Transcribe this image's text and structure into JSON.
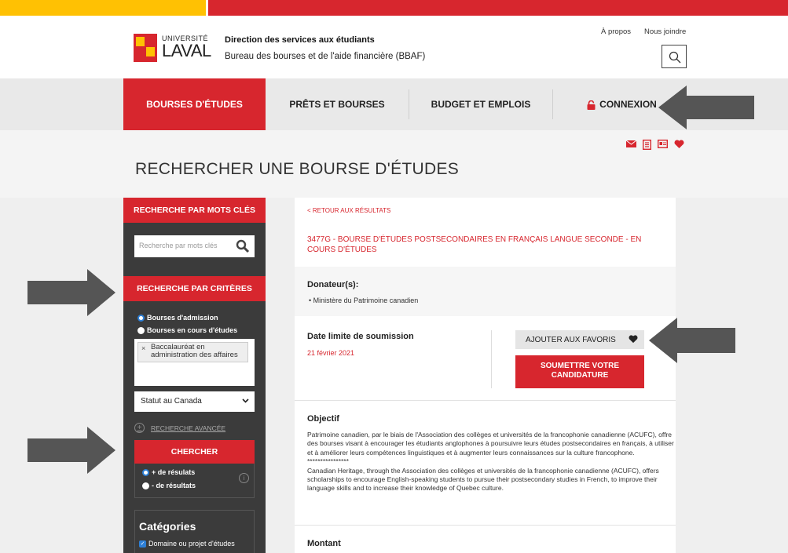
{
  "header": {
    "logo_small": "UNIVERSITÉ",
    "logo_large": "LAVAL",
    "title": "Direction des services aux étudiants",
    "subtitle": "Bureau des bourses et de l'aide financière (BBAF)",
    "links": [
      "À propos",
      "Nous joindre"
    ]
  },
  "nav": {
    "items": [
      {
        "label": "BOURSES D'ÉTUDES",
        "active": true
      },
      {
        "label": "PRÊTS ET BOURSES",
        "active": false
      },
      {
        "label": "BUDGET ET EMPLOIS",
        "active": false
      },
      {
        "label": "CONNEXION",
        "active": false,
        "icon": "lock-icon"
      }
    ]
  },
  "toolbar_icons": [
    "mail-icon",
    "document-icon",
    "card-icon",
    "heart-icon"
  ],
  "page_title": "RECHERCHER UNE BOURSE D'ÉTUDES",
  "sidebar": {
    "keyword_header": "RECHERCHE PAR MOTS CLÉS",
    "keyword_placeholder": "Recherche par mots clés",
    "criteria_header": "RECHERCHE PAR CRITÈRES",
    "radio_options": [
      {
        "label": "Bourses d'admission",
        "checked": true
      },
      {
        "label": "Bourses en cours d'études",
        "checked": false
      }
    ],
    "selected_tag": "Baccalauréat en administration des affaires",
    "status_select": "Statut au Canada",
    "advanced_link": "RECHERCHE AVANCÉE",
    "search_button": "CHERCHER",
    "sort_options": [
      {
        "label": "+ de résulats",
        "checked": true
      },
      {
        "label": "- de résultats",
        "checked": false
      }
    ],
    "info_glyph": "i",
    "categories_title": "Catégories",
    "category_checked": "Domaine ou projet d'études"
  },
  "main": {
    "back_link": "< RETOUR AUX RÉSULTATS",
    "title": "3477G - BOURSE D'ÉTUDES POSTSECONDAIRES EN FRANÇAIS LANGUE SECONDE - EN COURS D'ÉTUDES",
    "donors_label": "Donateur(s):",
    "donors": [
      "Ministère du Patrimoine canadien"
    ],
    "deadline_label": "Date limite de soumission",
    "deadline": "21 février 2021",
    "favorite_button": "AJOUTER AUX FAVORIS",
    "submit_button": "SOUMETTRE VOTRE CANDIDATURE",
    "objective_label": "Objectif",
    "objective_fr": "Patrimoine canadien, par le biais de l'Association des collèges et universités de la francophonie canadienne (ACUFC), offre des bourses visant à encourager les étudiants anglophones à poursuivre leurs études postsecondaires en français, à utiliser et à améliorer leurs compétences linguistiques et à augmenter leurs connaissances sur la culture francophone.",
    "objective_sep": "****************",
    "objective_en": "Canadian Heritage, through the Association des collèges et universités de la francophonie canadienne (ACUFC), offers scholarships to encourage English-speaking students to pursue their postsecondary studies in French, to improve their language skills and to increase their knowledge of Quebec culture.",
    "amount_label": "Montant"
  },
  "colors": {
    "brand_red": "#d7262e",
    "brand_gold": "#ffc103",
    "sidebar_bg": "#3b3b3b",
    "arrow": "#555555"
  }
}
